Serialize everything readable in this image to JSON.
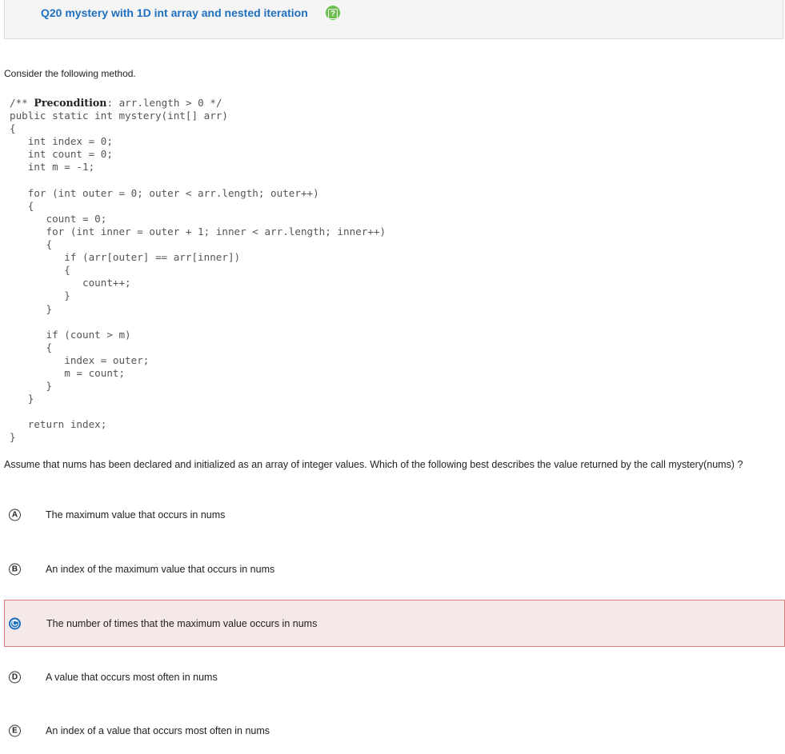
{
  "header": {
    "title": "Q20 mystery with 1D int array and nested iteration",
    "help_glyph": "?"
  },
  "intro": "Consider the following method.",
  "code": {
    "comment_open": "/** ",
    "comment_keyword": "Precondition",
    "comment_rest": ": arr.length > 0 */",
    "lines": [
      "public static int mystery(int[] arr)",
      "{",
      "   int index = 0;",
      "   int count = 0;",
      "   int m = -1;",
      "",
      "   for (int outer = 0; outer < arr.length; outer++)",
      "   {",
      "      count = 0;",
      "      for (int inner = outer + 1; inner < arr.length; inner++)",
      "      {",
      "         if (arr[outer] == arr[inner])",
      "         {",
      "            count++;",
      "         }",
      "      }",
      "",
      "      if (count > m)",
      "      {",
      "         index = outer;",
      "         m = count;",
      "      }",
      "   }",
      "",
      "   return index;",
      "}"
    ]
  },
  "question": "Assume that nums has been declared and initialized as an array of integer values. Which of the following best describes the value returned by the call mystery(nums) ?",
  "options": [
    {
      "letter": "A",
      "text": "The maximum value that occurs in nums"
    },
    {
      "letter": "B",
      "text": "An index of the maximum value that occurs in nums"
    },
    {
      "letter": "C",
      "text": "The number of times that the maximum value occurs in nums"
    },
    {
      "letter": "D",
      "text": "A value that occurs most often in nums"
    },
    {
      "letter": "E",
      "text": "An index of a value that occurs most often in nums"
    }
  ],
  "selected_option": "C",
  "colors": {
    "title": "#1f6fbf",
    "help_icon": "#6cbf4e",
    "selected_bg": "#f5e8e8",
    "selected_border": "#e07b7b",
    "selected_badge": "#1f6fbf"
  }
}
